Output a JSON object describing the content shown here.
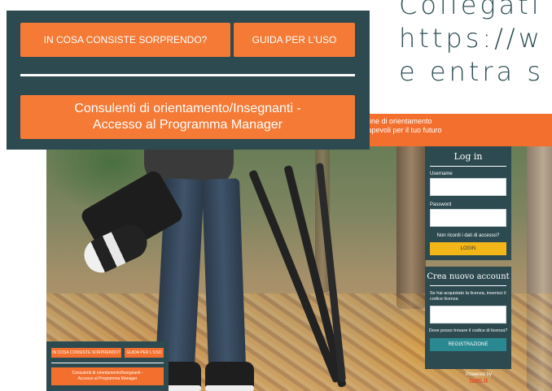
{
  "hero_text": {
    "line1": "Collegati",
    "line2": "https://w",
    "line3": "e entra s"
  },
  "site_header": {
    "line1": "online di orientamento",
    "line2": "nsapevoli per il tuo futuro"
  },
  "login": {
    "title": "Log in",
    "username_label": "Username",
    "password_label": "Password",
    "forgot_link": "Non ricordi i dati di accesso?",
    "login_button": "LOGIN"
  },
  "signup": {
    "title": "Crea nuovo account",
    "info": "Se hai acquistato la licenza, inserisci il codice licenza",
    "where_link": "Dove posso trovare il codice di licenza?",
    "register_button": "REGISTRAZIONE"
  },
  "powered": {
    "label": "Powered by",
    "logo": "tutti.it"
  },
  "nav": {
    "btn_about": "IN COSA CONSISTE SORPRENDO?",
    "btn_guide": "GUIDA PER L'USO",
    "btn_manager_line1": "Consulenti di orientamento/Insegnanti -",
    "btn_manager_line2": "Accesso al Programma Manager"
  },
  "mini_nav": {
    "btn_about": "IN COSA CONSISTE SORPRENDO?",
    "btn_guide": "GUIDA PER L'USO",
    "btn_manager_line1": "Consulenti di orientamento/Insegnanti -",
    "btn_manager_line2": "Accesso al Programma Manager"
  },
  "colors": {
    "panel": "#2d4a50",
    "orange": "#f47a35",
    "yellow": "#f2b619",
    "teal": "#2a8890"
  }
}
